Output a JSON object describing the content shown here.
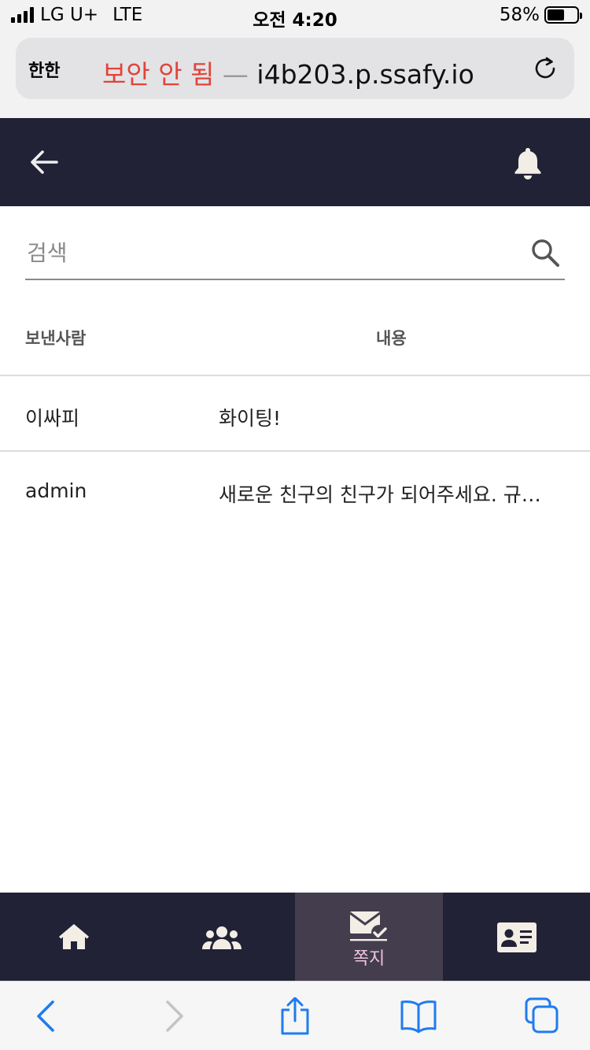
{
  "status_bar": {
    "carrier": "LG U+",
    "network": "LTE",
    "time": "오전 4:20",
    "battery_text": "58%",
    "battery_level": 0.58
  },
  "browser": {
    "aa_label": "한한",
    "security_warning": "보안 안 됨",
    "separator": "—",
    "domain": "i4b203.p.ssafy.io"
  },
  "header": {
    "back_icon": "arrow-left-icon",
    "notification_icon": "bell-icon"
  },
  "search": {
    "placeholder": "검색",
    "value": ""
  },
  "messages_table": {
    "columns": [
      "보낸사람",
      "내용"
    ],
    "rows": [
      {
        "sender": "이싸피",
        "content": "화이팅!"
      },
      {
        "sender": "admin",
        "content": "새로운 친구의 친구가 되어주세요. 규…"
      }
    ]
  },
  "bottom_nav": {
    "items": [
      {
        "icon": "home-icon",
        "label": ""
      },
      {
        "icon": "users-icon",
        "label": ""
      },
      {
        "icon": "mail-check-icon",
        "label": "쪽지",
        "active": true
      },
      {
        "icon": "id-card-icon",
        "label": ""
      }
    ]
  },
  "colors": {
    "header_bg": "#222236",
    "nav_active_bg": "#433d4e",
    "nav_active_label": "#f0c4e0",
    "warning_red": "#e0443a",
    "ios_blue": "#1e7cf0"
  }
}
